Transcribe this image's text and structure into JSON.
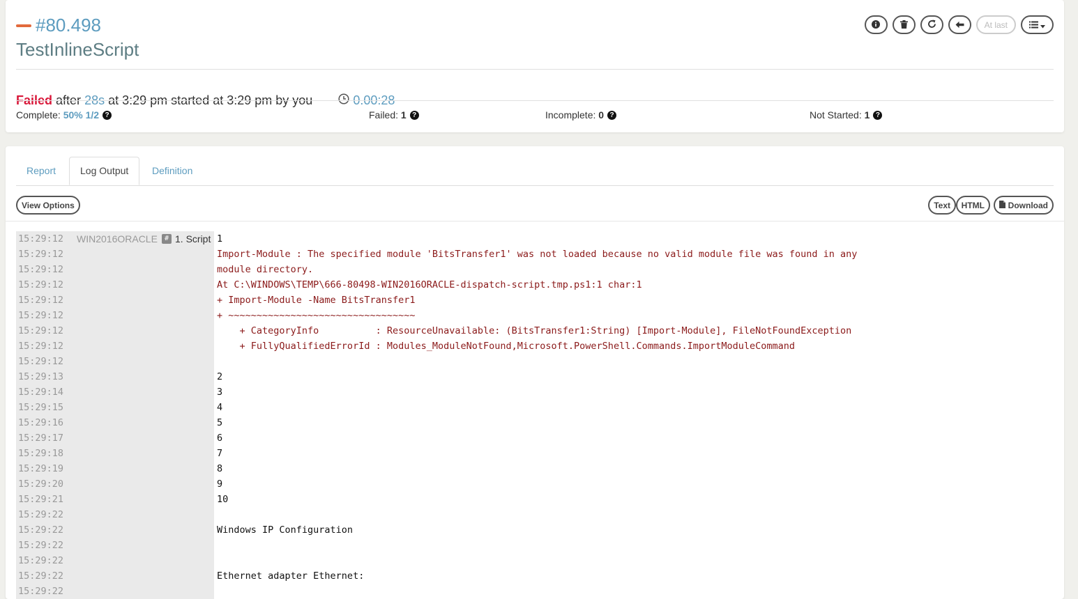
{
  "header": {
    "execution_number": "#80.498",
    "job_name": "TestInlineScript",
    "buttons": {
      "info_icon": "info-icon",
      "delete_icon": "trash-icon",
      "rerun_icon": "refresh-icon",
      "back_icon": "arrow-left-icon",
      "at_last_label": "At last",
      "menu_icon": "list-icon"
    },
    "status": {
      "state": "Failed",
      "after_label": "after",
      "duration": "28s",
      "time_text": "at 3:29 pm started at 3:29 pm by you",
      "elapsed": "0.00:28"
    },
    "stats": {
      "complete_label": "Complete:",
      "complete_value": "50% 1/2",
      "failed_label": "Failed:",
      "failed_value": "1",
      "incomplete_label": "Incomplete:",
      "incomplete_value": "0",
      "not_started_label": "Not Started:",
      "not_started_value": "1"
    }
  },
  "tabs": [
    {
      "label": "Report",
      "active": false
    },
    {
      "label": "Log Output",
      "active": true
    },
    {
      "label": "Definition",
      "active": false
    }
  ],
  "toolbar": {
    "view_options": "View Options",
    "text": "Text",
    "html": "HTML",
    "download": "Download"
  },
  "log": {
    "node": "WIN2016ORACLE",
    "step_badge": "#",
    "step": "1. Script",
    "rows": [
      {
        "ts": "15:29:12",
        "msg": "1",
        "err": false
      },
      {
        "ts": "15:29:12",
        "msg": "Import-Module : The specified module 'BitsTransfer1' was not loaded because no valid module file was found in any",
        "err": true
      },
      {
        "ts": "15:29:12",
        "msg": "module directory.",
        "err": true
      },
      {
        "ts": "15:29:12",
        "msg": "At C:\\WINDOWS\\TEMP\\666-80498-WIN2016ORACLE-dispatch-script.tmp.ps1:1 char:1",
        "err": true
      },
      {
        "ts": "15:29:12",
        "msg": "+ Import-Module -Name BitsTransfer1",
        "err": true
      },
      {
        "ts": "15:29:12",
        "msg": "+ ~~~~~~~~~~~~~~~~~~~~~~~~~~~~~~~~~",
        "err": true
      },
      {
        "ts": "15:29:12",
        "msg": "    + CategoryInfo          : ResourceUnavailable: (BitsTransfer1:String) [Import-Module], FileNotFoundException",
        "err": true
      },
      {
        "ts": "15:29:12",
        "msg": "    + FullyQualifiedErrorId : Modules_ModuleNotFound,Microsoft.PowerShell.Commands.ImportModuleCommand",
        "err": true
      },
      {
        "ts": "15:29:12",
        "msg": "",
        "err": true
      },
      {
        "ts": "15:29:13",
        "msg": "2",
        "err": false
      },
      {
        "ts": "15:29:14",
        "msg": "3",
        "err": false
      },
      {
        "ts": "15:29:15",
        "msg": "4",
        "err": false
      },
      {
        "ts": "15:29:16",
        "msg": "5",
        "err": false
      },
      {
        "ts": "15:29:17",
        "msg": "6",
        "err": false
      },
      {
        "ts": "15:29:18",
        "msg": "7",
        "err": false
      },
      {
        "ts": "15:29:19",
        "msg": "8",
        "err": false
      },
      {
        "ts": "15:29:20",
        "msg": "9",
        "err": false
      },
      {
        "ts": "15:29:21",
        "msg": "10",
        "err": false
      },
      {
        "ts": "15:29:22",
        "msg": "",
        "err": false
      },
      {
        "ts": "15:29:22",
        "msg": "Windows IP Configuration",
        "err": false
      },
      {
        "ts": "15:29:22",
        "msg": "",
        "err": false
      },
      {
        "ts": "15:29:22",
        "msg": "",
        "err": false
      },
      {
        "ts": "15:29:22",
        "msg": "Ethernet adapter Ethernet:",
        "err": false
      },
      {
        "ts": "15:29:22",
        "msg": "",
        "err": false
      }
    ]
  },
  "colors": {
    "failed": "#d9183a",
    "link": "#5d9cbf",
    "error_text": "#8b1a1a",
    "status_bar": "#e26a3c"
  }
}
